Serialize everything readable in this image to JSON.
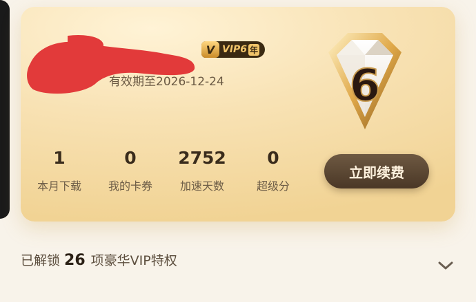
{
  "card": {
    "vip_badge": {
      "v": "V",
      "label": "VIP6",
      "year": "年"
    },
    "expire_text": "有效期至2026-12-24",
    "level_icon": "diamond-6-icon",
    "level_number": "6",
    "stats": [
      {
        "value": "1",
        "label": "本月下载"
      },
      {
        "value": "0",
        "label": "我的卡券"
      },
      {
        "value": "2752",
        "label": "加速天数"
      },
      {
        "value": "0",
        "label": "超级分"
      }
    ],
    "renew_button": "立即续费"
  },
  "privileges": {
    "prefix": "已解锁",
    "count": "26",
    "suffix": "项豪华VIP特权",
    "expand_icon": "chevron-down-icon"
  },
  "colors": {
    "card_gold": "#f1d394",
    "button_brown": "#4a3726",
    "text_dark": "#3a2c1c",
    "redaction_red": "#e23a3a"
  }
}
